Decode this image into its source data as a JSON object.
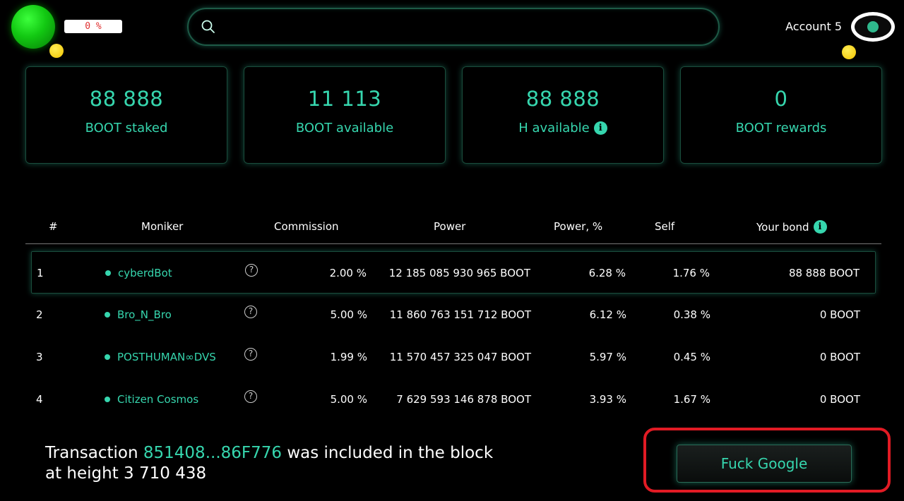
{
  "header": {
    "percent": "0 %",
    "search": {
      "value": "",
      "placeholder": ""
    },
    "account": "Account 5"
  },
  "cards": [
    {
      "value": "88 888",
      "label": "BOOT staked"
    },
    {
      "value": "11 113",
      "label": "BOOT available"
    },
    {
      "value": "88 888",
      "label": "H available"
    },
    {
      "value": "0",
      "label": "BOOT rewards"
    }
  ],
  "table": {
    "headers": {
      "idx": "#",
      "moniker": "Moniker",
      "commission": "Commission",
      "power": "Power",
      "power_pct": "Power, %",
      "self": "Self",
      "bond": "Your bond"
    },
    "rows": [
      {
        "idx": "1",
        "moniker": "cyberdBot",
        "commission": "2.00  %",
        "power": "12 185 085 930 965  BOOT",
        "power_pct": "6.28  %",
        "self": "1.76  %",
        "bond": "88 888  BOOT"
      },
      {
        "idx": "2",
        "moniker": "Bro_N_Bro",
        "commission": "5.00  %",
        "power": "11 860 763 151 712  BOOT",
        "power_pct": "6.12  %",
        "self": "0.38  %",
        "bond": "0  BOOT"
      },
      {
        "idx": "3",
        "moniker": "POSTHUMAN∞DVS",
        "commission": "1.99  %",
        "power": "11 570 457 325 047  BOOT",
        "power_pct": "5.97  %",
        "self": "0.45  %",
        "bond": "0  BOOT"
      },
      {
        "idx": "4",
        "moniker": "Citizen Cosmos",
        "commission": "5.00  %",
        "power": "7 629 593 146 878  BOOT",
        "power_pct": "3.93  %",
        "self": "1.67  %",
        "bond": "0  BOOT"
      }
    ]
  },
  "notification": {
    "prefix": "Transaction ",
    "hash": "851408...86F776",
    "middle": " was included in the block",
    "suffix": "at height 3 710 438"
  },
  "action_button": "Fuck Google",
  "colors": {
    "accent": "#36d6ae",
    "highlight": "#e11b24",
    "background": "#000000"
  }
}
